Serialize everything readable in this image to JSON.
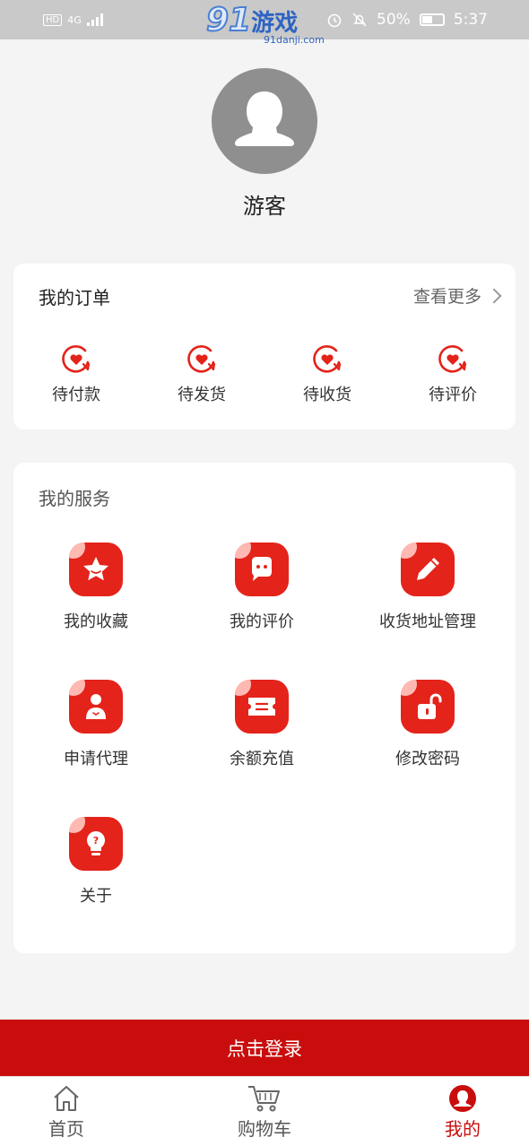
{
  "status_bar": {
    "network": "4G",
    "hd": "HD",
    "battery": "50%",
    "time": "5:37"
  },
  "watermark": {
    "number": "91",
    "name": "游戏",
    "site": "91danji.com"
  },
  "profile": {
    "username": "游客"
  },
  "orders": {
    "title": "我的订单",
    "more_label": "查看更多",
    "items": [
      {
        "label": "待付款",
        "icon": "heart-refresh-icon"
      },
      {
        "label": "待发货",
        "icon": "heart-refresh-icon"
      },
      {
        "label": "待收货",
        "icon": "heart-refresh-icon"
      },
      {
        "label": "待评价",
        "icon": "heart-refresh-icon"
      }
    ]
  },
  "services": {
    "title": "我的服务",
    "items": [
      {
        "label": "我的收藏",
        "icon": "star-icon"
      },
      {
        "label": "我的评价",
        "icon": "chat-bubble-icon"
      },
      {
        "label": "收货地址管理",
        "icon": "pencil-icon"
      },
      {
        "label": "申请代理",
        "icon": "person-icon"
      },
      {
        "label": "余额充值",
        "icon": "ticket-icon"
      },
      {
        "label": "修改密码",
        "icon": "unlock-icon"
      },
      {
        "label": "关于",
        "icon": "lightbulb-icon"
      }
    ]
  },
  "login_button": "点击登录",
  "tabs": [
    {
      "label": "首页",
      "icon": "home-icon",
      "active": false
    },
    {
      "label": "购物车",
      "icon": "cart-icon",
      "active": false
    },
    {
      "label": "我的",
      "icon": "profile-icon",
      "active": true
    }
  ],
  "colors": {
    "accent": "#c90d0d",
    "icon_red": "#e4231a",
    "background": "#f4f4f4"
  }
}
